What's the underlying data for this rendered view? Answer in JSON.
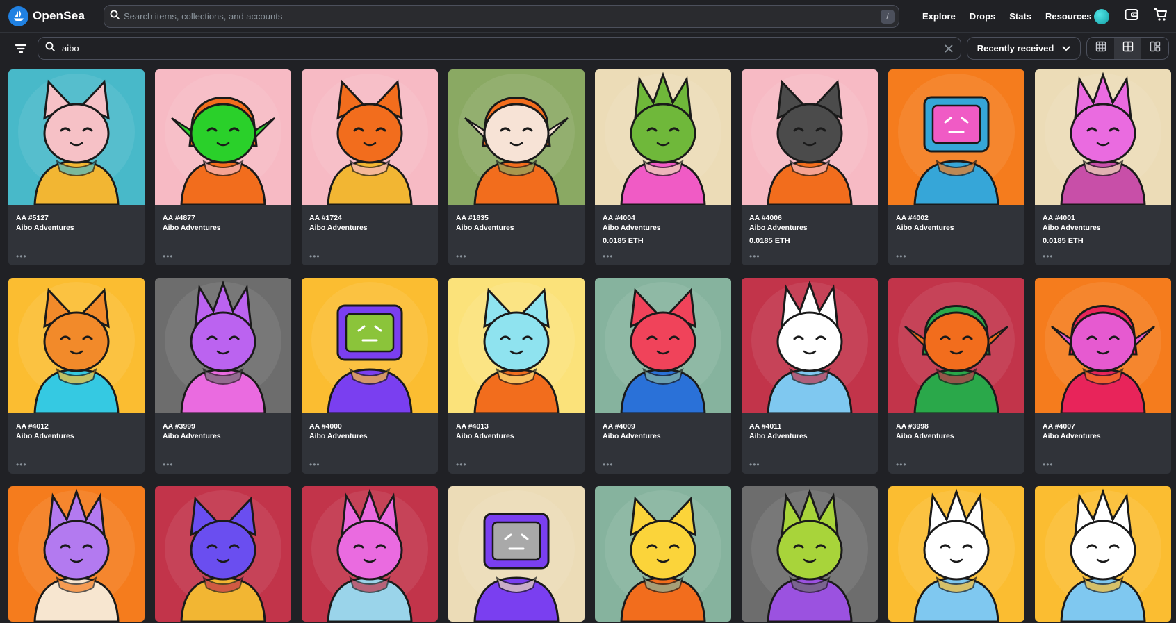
{
  "brand": {
    "name": "OpenSea",
    "accent": "#2081e2"
  },
  "search": {
    "placeholder": "Search items, collections, and accounts",
    "shortcut": "/"
  },
  "nav": {
    "links": [
      "Explore",
      "Drops",
      "Stats",
      "Resources"
    ]
  },
  "filter": {
    "query": "aibo",
    "sort": "Recently received"
  },
  "items": [
    {
      "id": "AA #5127",
      "collection": "Aibo Adventures",
      "price": "",
      "bg": "#48b9c9",
      "char": "#f6c1c6",
      "accent": "#f2b633",
      "ears": "cat"
    },
    {
      "id": "AA #4877",
      "collection": "Aibo Adventures",
      "price": "",
      "bg": "#f7bac4",
      "char": "#2ad02a",
      "accent": "#f26d1d",
      "ears": "elf"
    },
    {
      "id": "AA #1724",
      "collection": "Aibo Adventures",
      "price": "",
      "bg": "#f7bac4",
      "char": "#f26d1d",
      "accent": "#f2b633",
      "ears": "cat"
    },
    {
      "id": "AA #1835",
      "collection": "Aibo Adventures",
      "price": "",
      "bg": "#8aa963",
      "char": "#f7e3d6",
      "accent": "#f26d1d",
      "ears": "elf"
    },
    {
      "id": "AA #4004",
      "collection": "Aibo Adventures",
      "price": "0.0185 ETH",
      "bg": "#ecdcb7",
      "char": "#6fb83a",
      "accent": "#f05bc5",
      "ears": "spike"
    },
    {
      "id": "AA #4006",
      "collection": "Aibo Adventures",
      "price": "0.0185 ETH",
      "bg": "#f7bac4",
      "char": "#4b4b4b",
      "accent": "#f26d1d",
      "ears": "cat"
    },
    {
      "id": "AA #4002",
      "collection": "Aibo Adventures",
      "price": "",
      "bg": "#f57c1d",
      "char": "#f05bc5",
      "accent": "#36a6d8",
      "ears": "tv"
    },
    {
      "id": "AA #4001",
      "collection": "Aibo Adventures",
      "price": "0.0185 ETH",
      "bg": "#ecdcb7",
      "char": "#ea6be0",
      "accent": "#c84fa8",
      "ears": "spike"
    },
    {
      "id": "AA #4012",
      "collection": "Aibo Adventures",
      "price": "",
      "bg": "#fbbd31",
      "char": "#f28a2a",
      "accent": "#35c9e2",
      "ears": "cat"
    },
    {
      "id": "AA #3999",
      "collection": "Aibo Adventures",
      "price": "",
      "bg": "#6d6d6d",
      "char": "#bb63f0",
      "accent": "#ea6be0",
      "ears": "spike"
    },
    {
      "id": "AA #4000",
      "collection": "Aibo Adventures",
      "price": "",
      "bg": "#fbbd31",
      "char": "#8bc43a",
      "accent": "#7a3ff0",
      "ears": "tv"
    },
    {
      "id": "AA #4013",
      "collection": "Aibo Adventures",
      "price": "",
      "bg": "#fbe27a",
      "char": "#8fe3ef",
      "accent": "#f26d1d",
      "ears": "cat"
    },
    {
      "id": "AA #4009",
      "collection": "Aibo Adventures",
      "price": "",
      "bg": "#86b39e",
      "char": "#f0435a",
      "accent": "#2a71d8",
      "ears": "cat"
    },
    {
      "id": "AA #4011",
      "collection": "Aibo Adventures",
      "price": "",
      "bg": "#c2344a",
      "char": "#ffffff",
      "accent": "#7fc8f0",
      "ears": "spike"
    },
    {
      "id": "AA #3998",
      "collection": "Aibo Adventures",
      "price": "",
      "bg": "#c2344a",
      "char": "#f26d1d",
      "accent": "#2aa84a",
      "ears": "elf"
    },
    {
      "id": "AA #4007",
      "collection": "Aibo Adventures",
      "price": "",
      "bg": "#f57c1d",
      "char": "#e65ad0",
      "accent": "#e8245a",
      "ears": "elf"
    },
    {
      "id": "",
      "collection": "",
      "price": "",
      "bg": "#f57c1d",
      "char": "#b37af0",
      "accent": "#f7e6d0",
      "ears": "spike"
    },
    {
      "id": "",
      "collection": "",
      "price": "",
      "bg": "#c2344a",
      "char": "#6a4ef0",
      "accent": "#f2b633",
      "ears": "cat"
    },
    {
      "id": "",
      "collection": "",
      "price": "",
      "bg": "#c2344a",
      "char": "#ea6be0",
      "accent": "#9ad4ea",
      "ears": "spike"
    },
    {
      "id": "",
      "collection": "",
      "price": "",
      "bg": "#ecdcb7",
      "char": "#a9a9a9",
      "accent": "#7a3ff0",
      "ears": "tv"
    },
    {
      "id": "",
      "collection": "",
      "price": "",
      "bg": "#86b39e",
      "char": "#fbd43a",
      "accent": "#f26d1d",
      "ears": "cat"
    },
    {
      "id": "",
      "collection": "",
      "price": "",
      "bg": "#6d6d6d",
      "char": "#a8d43a",
      "accent": "#9b52e0",
      "ears": "spike"
    },
    {
      "id": "",
      "collection": "",
      "price": "",
      "bg": "#fbbd31",
      "char": "#ffffff",
      "accent": "#7fc8f0",
      "ears": "spike"
    },
    {
      "id": "",
      "collection": "",
      "price": "",
      "bg": "#fbbd31",
      "char": "#ffffff",
      "accent": "#7fc8f0",
      "ears": "spike"
    }
  ]
}
